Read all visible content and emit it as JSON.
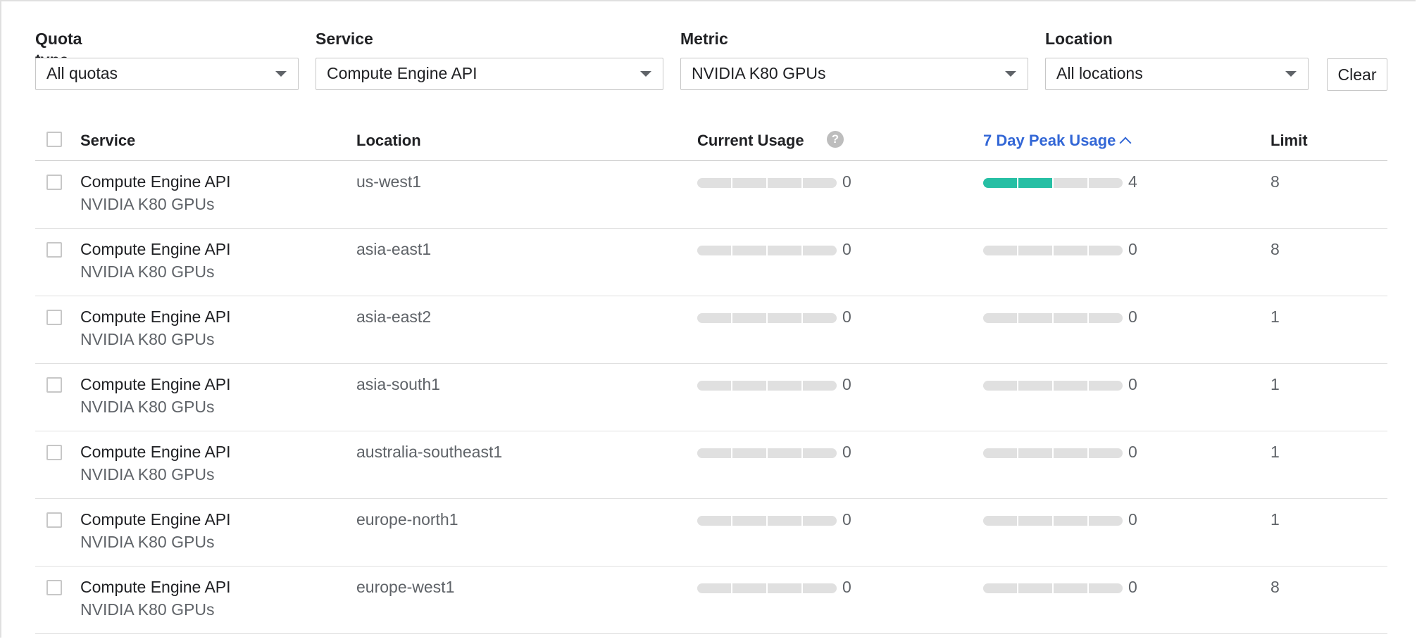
{
  "filters": [
    {
      "label": "Quota type",
      "value": "All quotas"
    },
    {
      "label": "Service",
      "value": "Compute Engine API"
    },
    {
      "label": "Metric",
      "value": "NVIDIA K80 GPUs"
    },
    {
      "label": "Location",
      "value": "All locations"
    }
  ],
  "clear_label": "Clear",
  "columns": {
    "service": "Service",
    "location": "Location",
    "current_usage": "Current Usage",
    "help_glyph": "?",
    "peak_usage": "7 Day Peak Usage",
    "limit": "Limit"
  },
  "colors": {
    "accent": "#3367d6",
    "bar_fill": "#26bfa4",
    "bar_empty": "#e0e0e0"
  },
  "rows": [
    {
      "service": "Compute Engine API",
      "metric": "NVIDIA K80 GPUs",
      "location": "us-west1",
      "current": "0",
      "peak": "4",
      "limit": "8",
      "peak_fraction": 0.5,
      "current_fraction": 0
    },
    {
      "service": "Compute Engine API",
      "metric": "NVIDIA K80 GPUs",
      "location": "asia-east1",
      "current": "0",
      "peak": "0",
      "limit": "8",
      "peak_fraction": 0,
      "current_fraction": 0
    },
    {
      "service": "Compute Engine API",
      "metric": "NVIDIA K80 GPUs",
      "location": "asia-east2",
      "current": "0",
      "peak": "0",
      "limit": "1",
      "peak_fraction": 0,
      "current_fraction": 0
    },
    {
      "service": "Compute Engine API",
      "metric": "NVIDIA K80 GPUs",
      "location": "asia-south1",
      "current": "0",
      "peak": "0",
      "limit": "1",
      "peak_fraction": 0,
      "current_fraction": 0
    },
    {
      "service": "Compute Engine API",
      "metric": "NVIDIA K80 GPUs",
      "location": "australia-southeast1",
      "current": "0",
      "peak": "0",
      "limit": "1",
      "peak_fraction": 0,
      "current_fraction": 0
    },
    {
      "service": "Compute Engine API",
      "metric": "NVIDIA K80 GPUs",
      "location": "europe-north1",
      "current": "0",
      "peak": "0",
      "limit": "1",
      "peak_fraction": 0,
      "current_fraction": 0
    },
    {
      "service": "Compute Engine API",
      "metric": "NVIDIA K80 GPUs",
      "location": "europe-west1",
      "current": "0",
      "peak": "0",
      "limit": "8",
      "peak_fraction": 0,
      "current_fraction": 0
    }
  ]
}
